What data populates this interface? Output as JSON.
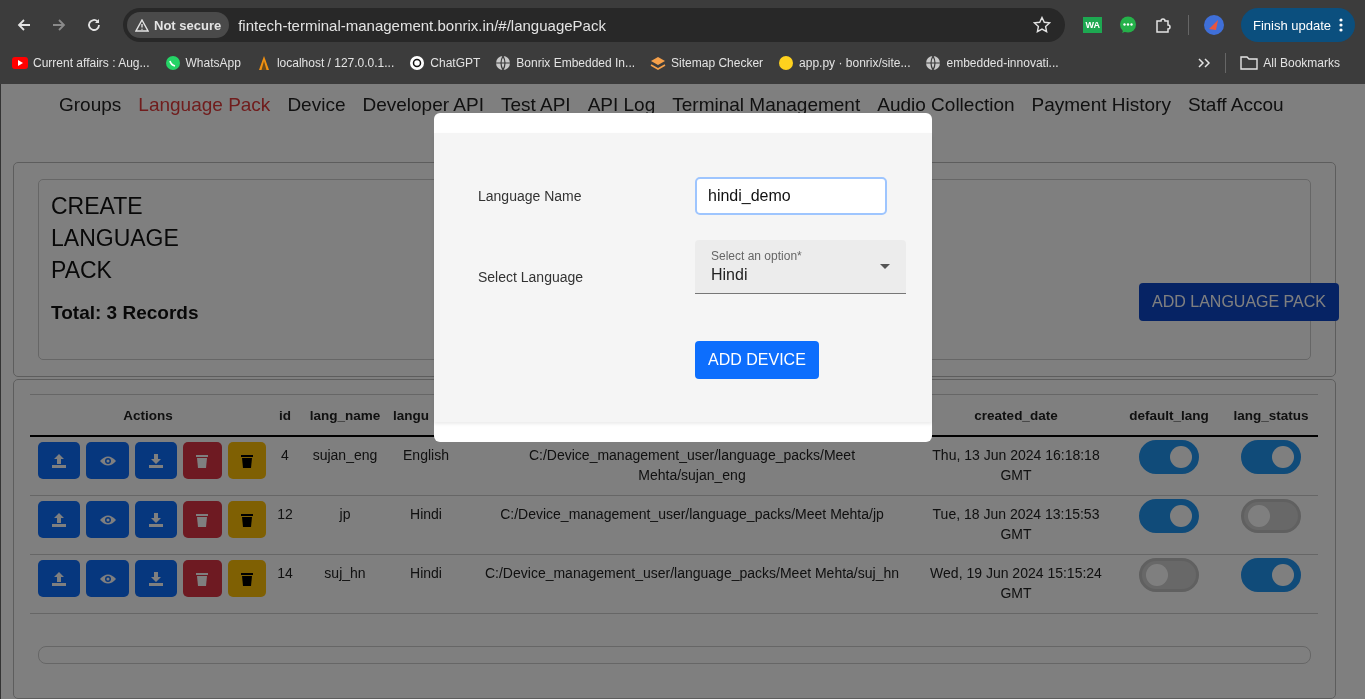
{
  "browser": {
    "security": "Not secure",
    "url": "fintech-terminal-management.bonrix.in/#/languagePack",
    "extension": "WA",
    "update_button": "Finish update",
    "bookmarks": [
      {
        "kind": "play",
        "label": "Current affairs : Aug..."
      },
      {
        "kind": "chat",
        "label": "WhatsApp"
      },
      {
        "kind": "flame",
        "label": "localhost / 127.0.0.1..."
      },
      {
        "kind": "knot",
        "label": "ChatGPT"
      },
      {
        "kind": "globe",
        "label": "Bonrix Embedded In..."
      },
      {
        "kind": "layers",
        "label": "Sitemap Checker"
      },
      {
        "kind": "emoji",
        "label": "app.py · bonrix/site..."
      },
      {
        "kind": "globe",
        "label": "embedded-innovati..."
      }
    ],
    "all_bookmarks": "All Bookmarks"
  },
  "nav": [
    {
      "label": "Groups",
      "selected": false
    },
    {
      "label": "Language Pack",
      "selected": true
    },
    {
      "label": "Device",
      "selected": false
    },
    {
      "label": "Developer API",
      "selected": false
    },
    {
      "label": "Test API",
      "selected": false
    },
    {
      "label": "API Log",
      "selected": false
    },
    {
      "label": "Terminal Management",
      "selected": false
    },
    {
      "label": "Audio Collection",
      "selected": false
    },
    {
      "label": "Payment History",
      "selected": false
    },
    {
      "label": "Staff Accou",
      "selected": false
    }
  ],
  "summary": {
    "title": "CREATE LANGUAGE PACK",
    "total": "Total: 3 Records",
    "add_button": "ADD LANGUAGE PACK"
  },
  "table": {
    "columns": [
      "Actions",
      "id",
      "lang_name",
      "langu",
      "",
      "created_date",
      "default_lang",
      "lang_status"
    ],
    "rows": [
      {
        "id": "4",
        "lang_name": "sujan_eng",
        "language": "English",
        "path": "C:/Device_management_user/language_packs/Meet Mehta/sujan_eng",
        "created_date": "Thu, 13 Jun 2024 16:18:18 GMT",
        "default_lang": true,
        "lang_status": true
      },
      {
        "id": "12",
        "lang_name": "jp",
        "language": "Hindi",
        "path": "C:/Device_management_user/language_packs/Meet Mehta/jp",
        "created_date": "Tue, 18 Jun 2024 13:15:53 GMT",
        "default_lang": true,
        "lang_status": false
      },
      {
        "id": "14",
        "lang_name": "suj_hn",
        "language": "Hindi",
        "path": "C:/Device_management_user/language_packs/Meet Mehta/suj_hn",
        "created_date": "Wed, 19 Jun 2024 15:15:24 GMT",
        "default_lang": false,
        "lang_status": true
      }
    ]
  },
  "dialog": {
    "fields": [
      {
        "kind": "text",
        "label": "Language Name",
        "value": "hindi_demo"
      },
      {
        "kind": "select",
        "label": "Select Language",
        "placeholder": "Select an option*",
        "value": "Hindi"
      }
    ],
    "submit_button": "ADD DEVICE"
  }
}
